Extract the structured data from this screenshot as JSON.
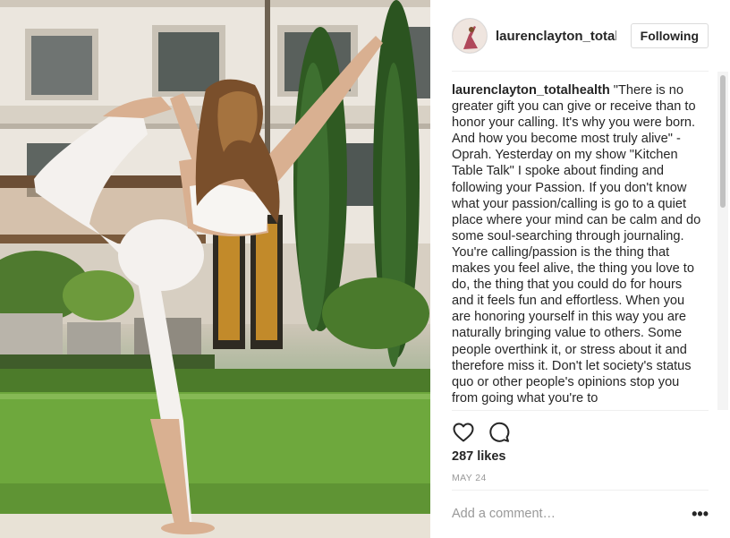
{
  "post": {
    "username": "laurenclayton_totalhealth",
    "follow_label": "Following",
    "caption": "\"There is no greater gift you can give or receive than to honor your calling. It's why you were born. And how you become most truly alive\" -Oprah. Yesterday on my show \"Kitchen Table Talk\" I spoke about finding and following your Passion. If you don't know what your passion/calling is go to a quiet place where your mind can be calm and do some soul-searching through journaling. You're calling/passion is the thing that makes you feel alive, the thing you love to do, the thing that you could do for hours and it feels fun and effortless. When you are honoring yourself in this way you are naturally bringing value to others. Some people overthink it, or stress about it and therefore miss it. Don't let society's status quo or other people's opinions stop you from going what you're to",
    "likes": "287 likes",
    "date": "MAY 24"
  },
  "actions": {
    "like_icon": "heart-icon",
    "comment_icon": "comment-bubble-icon",
    "more_icon": "more-options-icon"
  },
  "comment_box": {
    "placeholder": "Add a comment…",
    "value": ""
  },
  "colors": {
    "text": "#262626",
    "muted": "#999999",
    "border": "#dbdbdb"
  }
}
